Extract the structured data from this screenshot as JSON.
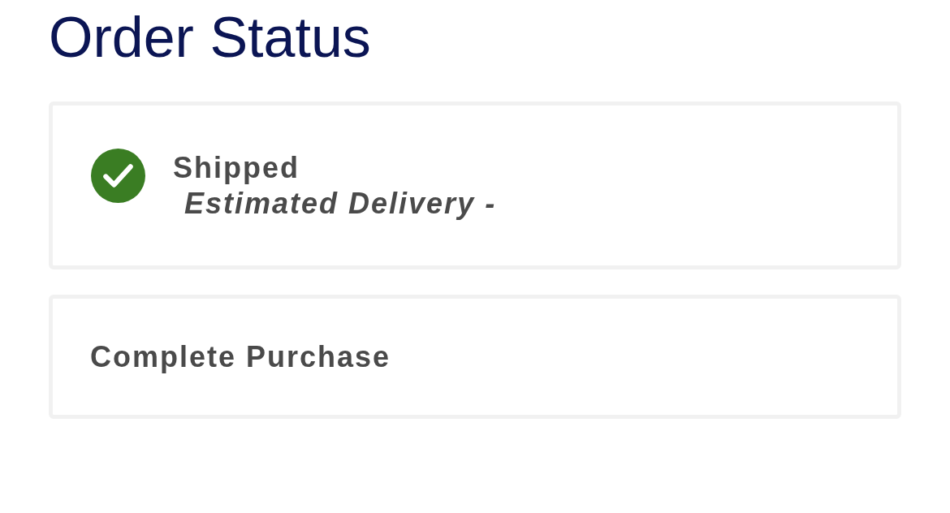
{
  "title": "Order Status",
  "steps": [
    {
      "kind": "status",
      "label": "Shipped",
      "detail": "Estimated Delivery -",
      "completed": true
    },
    {
      "kind": "action",
      "label": "Complete Purchase"
    }
  ]
}
